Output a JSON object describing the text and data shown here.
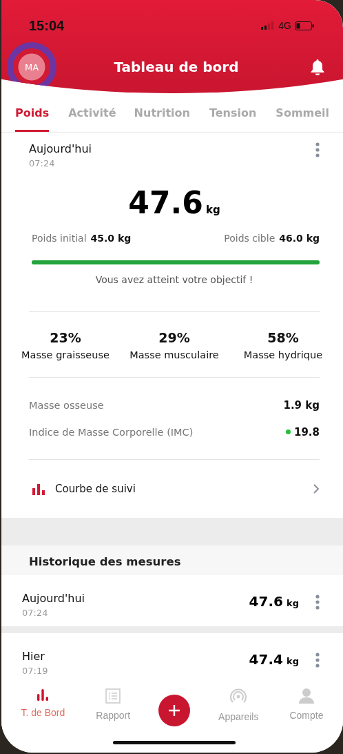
{
  "status_bar": {
    "time": "15:04",
    "network": "4G"
  },
  "header": {
    "avatar": "MA",
    "title": "Tableau de bord"
  },
  "tabs": [
    {
      "label": "Poids",
      "selected": true
    },
    {
      "label": "Activité",
      "selected": false
    },
    {
      "label": "Nutrition",
      "selected": false
    },
    {
      "label": "Tension",
      "selected": false
    },
    {
      "label": "Sommeil",
      "selected": false
    }
  ],
  "summary": {
    "day": "Aujourd'hui",
    "time": "07:24",
    "weight": "47.6",
    "unit": "kg",
    "initial_label": "Poids initial",
    "initial_value": "45.0 kg",
    "target_label": "Poids cible",
    "target_value": "46.0 kg",
    "level": 1,
    "message": "Vous avez atteint votre objectif !"
  },
  "composition": [
    {
      "value": "23%",
      "label": "Masse graisseuse"
    },
    {
      "value": "29%",
      "label": "Masse musculaire"
    },
    {
      "value": "58%",
      "label": "Masse hydrique"
    }
  ],
  "metrics": [
    {
      "label": "Masse osseuse",
      "value": "1.9 kg"
    },
    {
      "label": "Indice de Masse Corporelle (IMC)",
      "value": "19.8",
      "color": "#22c03c"
    }
  ],
  "trend_link": "Courbe de suivi",
  "history": {
    "title": "Historique des mesures",
    "rows": [
      {
        "day": "Aujourd'hui",
        "time": "07:24",
        "weight": "47.6",
        "unit": "kg"
      },
      {
        "day": "Hier",
        "time": "07:19",
        "weight": "47.4",
        "unit": "kg"
      }
    ]
  },
  "nav": [
    {
      "label": "T. de Bord",
      "kind": "chart",
      "selected": true
    },
    {
      "label": "Rapport",
      "kind": "report",
      "selected": false
    },
    {
      "kind": "add",
      "selected": false
    },
    {
      "label": "Appareils",
      "kind": "devices",
      "selected": false
    },
    {
      "label": "Compte",
      "kind": "account",
      "selected": false
    }
  ]
}
